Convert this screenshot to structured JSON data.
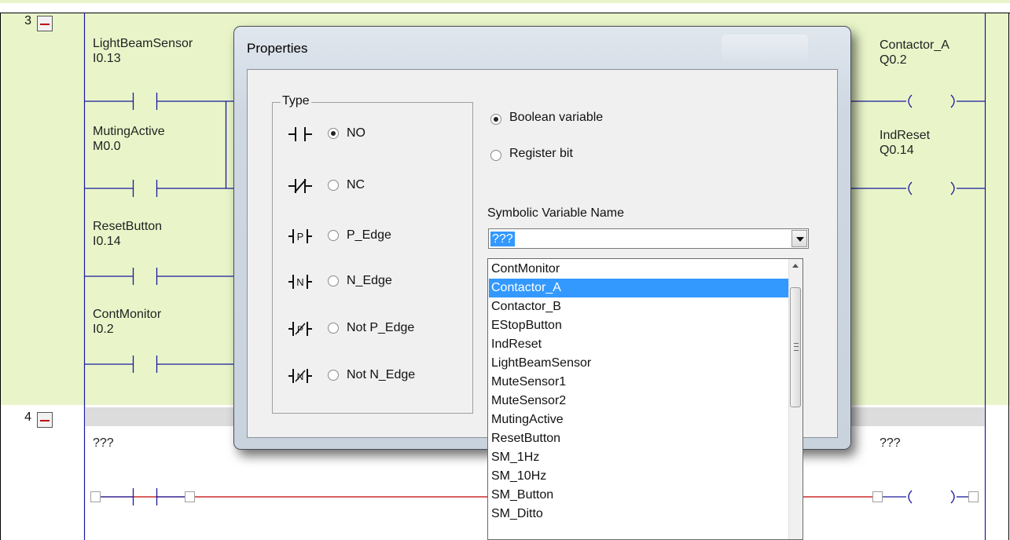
{
  "rungs": [
    {
      "number": "3",
      "contacts": [
        {
          "name": "LightBeamSensor",
          "address": "I0.13"
        },
        {
          "name": "MutingActive",
          "address": "M0.0"
        },
        {
          "name": "ResetButton",
          "address": "I0.14"
        },
        {
          "name": "ContMonitor",
          "address": "I0.2"
        }
      ],
      "coils": [
        {
          "name": "Contactor_A",
          "address": "Q0.2"
        },
        {
          "name": "IndReset",
          "address": "Q0.14"
        }
      ]
    },
    {
      "number": "4",
      "contact_name": "???",
      "coil_name": "???"
    }
  ],
  "dialog": {
    "title": "Properties",
    "type_legend": "Type",
    "types": [
      {
        "label": "NO",
        "selected": true,
        "icon": "contact-no-icon"
      },
      {
        "label": "NC",
        "selected": false,
        "icon": "contact-nc-icon"
      },
      {
        "label": "P_Edge",
        "selected": false,
        "icon": "contact-p-edge-icon"
      },
      {
        "label": "N_Edge",
        "selected": false,
        "icon": "contact-n-edge-icon"
      },
      {
        "label": "Not P_Edge",
        "selected": false,
        "icon": "contact-not-p-edge-icon"
      },
      {
        "label": "Not N_Edge",
        "selected": false,
        "icon": "contact-not-n-edge-icon"
      }
    ],
    "variable_kinds": [
      {
        "label": "Boolean variable",
        "selected": true
      },
      {
        "label": "Register bit",
        "selected": false
      }
    ],
    "symbolic_label": "Symbolic Variable Name",
    "symbolic_value": "???",
    "options": [
      "ContMonitor",
      "Contactor_A",
      "Contactor_B",
      "EStopButton",
      "IndReset",
      "LightBeamSensor",
      "MuteSensor1",
      "MuteSensor2",
      "MutingActive",
      "ResetButton",
      "SM_1Hz",
      "SM_10Hz",
      "SM_Button",
      "SM_Ditto"
    ],
    "selected_option": "Contactor_A"
  },
  "colors": {
    "rung_background": "#e9f5c9",
    "wire": "#1a1a9e",
    "empty_wire": "#c00000",
    "selection": "#3399ff"
  }
}
